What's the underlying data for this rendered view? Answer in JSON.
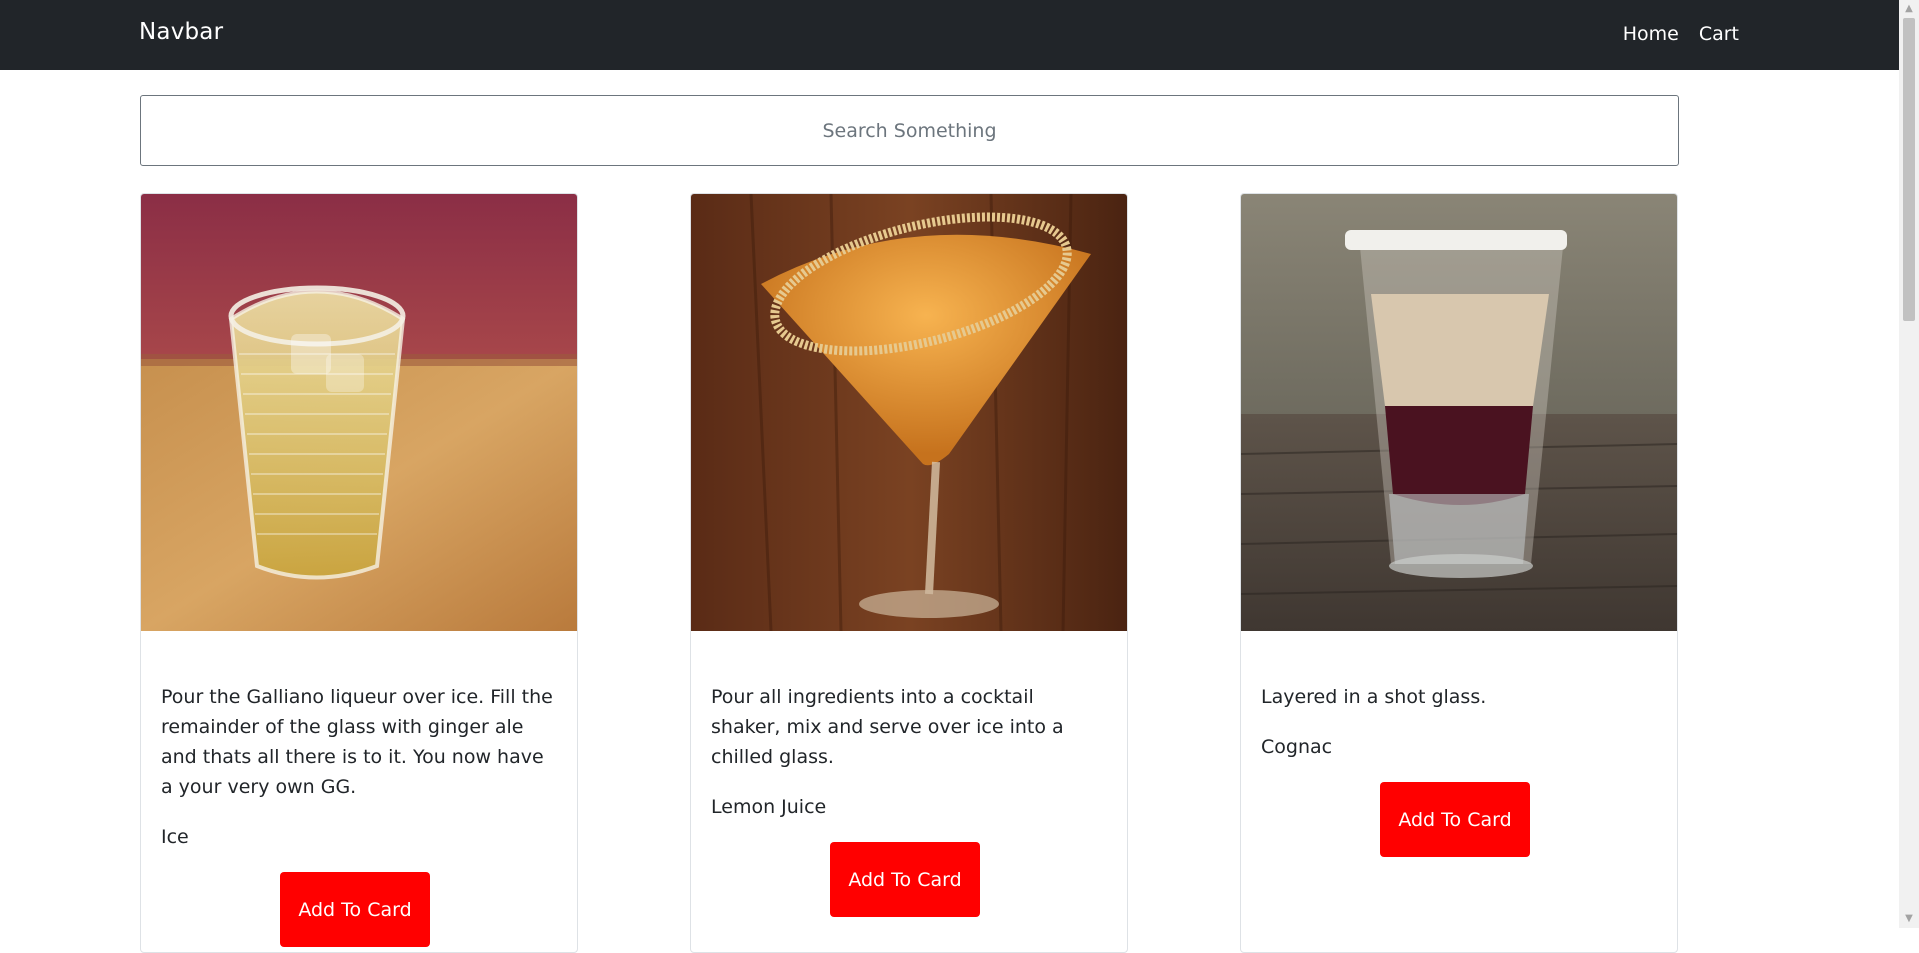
{
  "navbar": {
    "brand": "Navbar",
    "links": [
      "Home",
      "Cart"
    ]
  },
  "search": {
    "placeholder": "Search Something",
    "value": ""
  },
  "cards": [
    {
      "image": "glass-tumbler-galliano-drink",
      "description": "Pour the Galliano liqueur over ice. Fill the remainder of the glass with ginger ale and thats all there is to it. You now have a your very own GG.",
      "ingredient": "Ice",
      "button": "Add To Card"
    },
    {
      "image": "martini-glass-orange-cocktail",
      "description": "Pour all ingredients into a cocktail shaker, mix and serve over ice into a chilled glass.",
      "ingredient": "Lemon Juice",
      "button": "Add To Card"
    },
    {
      "image": "layered-shot-glass",
      "description": "Layered in a shot glass.",
      "ingredient": "Cognac",
      "button": "Add To Card"
    }
  ],
  "colors": {
    "navbar_bg": "#212529",
    "button_bg": "#ff0000"
  }
}
